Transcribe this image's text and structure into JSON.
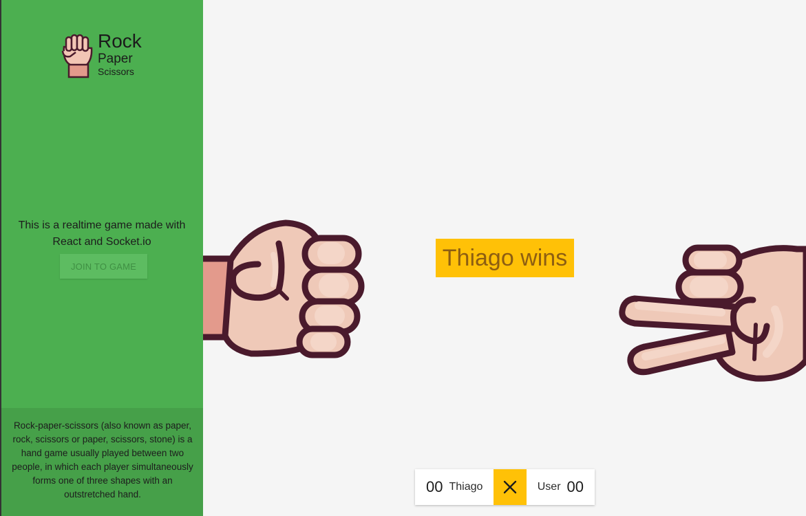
{
  "app": {
    "logo": {
      "line1": "Rock",
      "line2": "Paper",
      "line3": "Scissors"
    },
    "intro": "This is a realtime game made with React and Socket.io",
    "join_label": "JOIN TO GAME",
    "about": "Rock-paper-scissors (also known as paper, rock, scissors or paper, scissors, stone) is a hand game usually played between two people, in which each player simultaneously forms one of three shapes with an outstretched hand."
  },
  "game": {
    "result": "Thiago wins",
    "left_hand": "rock-fist-icon",
    "right_hand": "scissors-hand-icon"
  },
  "scoreboard": {
    "player1": {
      "name": "Thiago",
      "score": "00"
    },
    "player2": {
      "name": "User",
      "score": "00"
    },
    "middle_icon": "close-icon"
  },
  "colors": {
    "sidebar": "#4caf50",
    "about_panel": "#46a049",
    "accent": "#ffc107",
    "background": "#f5f5f5",
    "skin": "#eec6b6",
    "outline": "#4a1a2c"
  }
}
